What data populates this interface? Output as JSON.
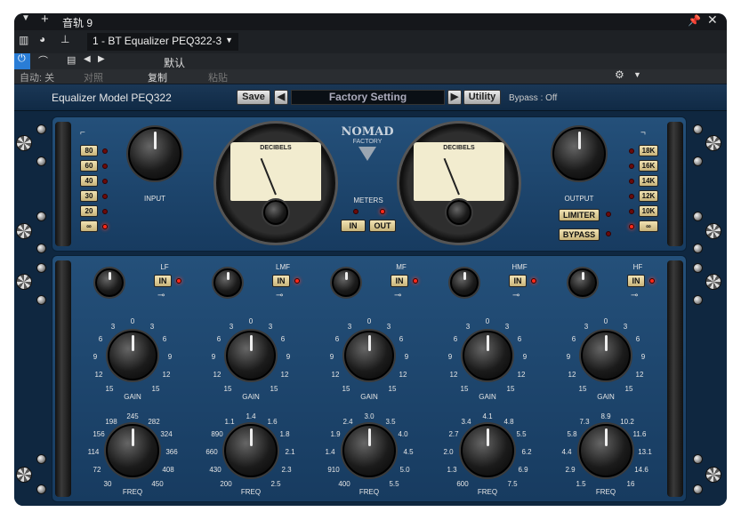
{
  "window": {
    "track_title": "音轨 9",
    "plugin_instance": "1 - BT Equalizer PEQ322-3",
    "preset_label": "默认",
    "auto_label": "自动: 关",
    "compare_label": "对照",
    "copy_label": "复制",
    "paste_label": "粘贴"
  },
  "plugin": {
    "model_title": "Equalizer Model PEQ322",
    "save_label": "Save",
    "preset": "Factory Setting",
    "utility_label": "Utility",
    "bypass_status": "Bypass : Off",
    "brand_line1": "NOMAD",
    "brand_line2": "FACTORY",
    "meters_label": "METERS",
    "meter_in": "IN",
    "meter_out": "OUT",
    "meter_face": "DECIBELS",
    "input_label": "INPUT",
    "output_label": "OUTPUT",
    "limiter_label": "LIMITER",
    "bypass_label": "BYPASS",
    "lowcut": [
      "80",
      "60",
      "40",
      "30",
      "20",
      "∞"
    ],
    "highcut": [
      "18K",
      "16K",
      "14K",
      "12K",
      "10K",
      "∞"
    ]
  },
  "bands": [
    {
      "name": "LF",
      "in": "IN",
      "gain": "GAIN",
      "freq": "FREQ",
      "gain_ticks": [
        "0",
        "3",
        "3",
        "6",
        "6",
        "9",
        "9",
        "12",
        "12",
        "15",
        "15"
      ],
      "freq_ticks": [
        "245",
        "198",
        "282",
        "156",
        "324",
        "114",
        "366",
        "72",
        "408",
        "30",
        "450"
      ]
    },
    {
      "name": "LMF",
      "in": "IN",
      "gain": "GAIN",
      "freq": "FREQ",
      "gain_ticks": [
        "0",
        "3",
        "3",
        "6",
        "6",
        "9",
        "9",
        "12",
        "12",
        "15",
        "15"
      ],
      "freq_ticks": [
        "1.4",
        "1.1",
        "1.6",
        "890",
        "1.8",
        "660",
        "2.1",
        "430",
        "2.3",
        "200",
        "2.5"
      ]
    },
    {
      "name": "MF",
      "in": "IN",
      "gain": "GAIN",
      "freq": "FREQ",
      "gain_ticks": [
        "0",
        "3",
        "3",
        "6",
        "6",
        "9",
        "9",
        "12",
        "12",
        "15",
        "15"
      ],
      "freq_ticks": [
        "3.0",
        "2.4",
        "3.5",
        "1.9",
        "4.0",
        "1.4",
        "4.5",
        "910",
        "5.0",
        "400",
        "5.5"
      ]
    },
    {
      "name": "HMF",
      "in": "IN",
      "gain": "GAIN",
      "freq": "FREQ",
      "gain_ticks": [
        "0",
        "3",
        "3",
        "6",
        "6",
        "9",
        "9",
        "12",
        "12",
        "15",
        "15"
      ],
      "freq_ticks": [
        "4.1",
        "3.4",
        "4.8",
        "2.7",
        "5.5",
        "2.0",
        "6.2",
        "1.3",
        "6.9",
        "600",
        "7.5"
      ]
    },
    {
      "name": "HF",
      "in": "IN",
      "gain": "GAIN",
      "freq": "FREQ",
      "gain_ticks": [
        "0",
        "3",
        "3",
        "6",
        "6",
        "9",
        "9",
        "12",
        "12",
        "15",
        "15"
      ],
      "freq_ticks": [
        "8.9",
        "7.3",
        "10.2",
        "5.8",
        "11.6",
        "4.4",
        "13.1",
        "2.9",
        "14.6",
        "1.5",
        "16"
      ]
    }
  ]
}
